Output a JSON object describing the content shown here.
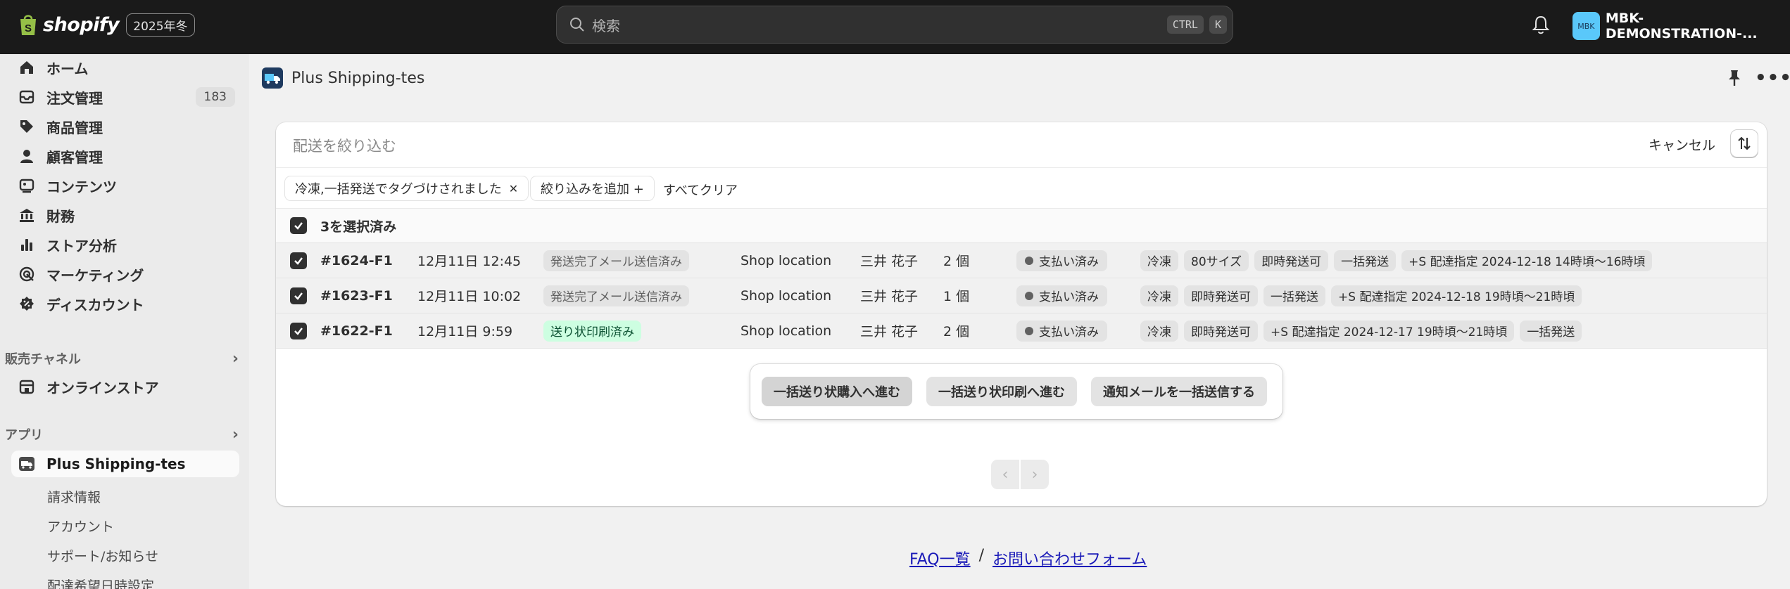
{
  "topbar": {
    "brand": "shopify",
    "edition": "2025年冬",
    "search_placeholder": "検索",
    "shortcut_keys": [
      "CTRL",
      "K"
    ],
    "store_avatar": "MBK",
    "store_name": "MBK-DEMONSTRATION-..."
  },
  "sidebar": {
    "items": [
      {
        "label": "ホーム",
        "icon": "home-icon"
      },
      {
        "label": "注文管理",
        "icon": "orders-icon",
        "badge": "183"
      },
      {
        "label": "商品管理",
        "icon": "tag-icon"
      },
      {
        "label": "顧客管理",
        "icon": "person-icon"
      },
      {
        "label": "コンテンツ",
        "icon": "content-icon"
      },
      {
        "label": "財務",
        "icon": "bank-icon"
      },
      {
        "label": "ストア分析",
        "icon": "analytics-icon"
      },
      {
        "label": "マーケティング",
        "icon": "target-icon"
      },
      {
        "label": "ディスカウント",
        "icon": "discount-icon"
      }
    ],
    "sales_channels_heading": "販売チャネル",
    "online_store": "オンラインストア",
    "apps_heading": "アプリ",
    "app_name": "Plus Shipping-tes",
    "app_sub_items": [
      "請求情報",
      "アカウント",
      "サポート/お知らせ",
      "配達希望日時設定"
    ]
  },
  "header": {
    "app_title": "Plus Shipping-tes"
  },
  "filter": {
    "placeholder": "配送を絞り込む",
    "cancel": "キャンセル",
    "active_chip": "冷凍,一括発送でタグづけされました",
    "add_filter": "絞り込みを追加 +",
    "clear_all": "すべてクリア"
  },
  "selection": {
    "label": "3を選択済み"
  },
  "orders": [
    {
      "no": "#1624-F1",
      "date": "12月11日 12:45",
      "status": "発送完了メール送信済み",
      "status_type": "gray",
      "location": "Shop location",
      "customer": "三井 花子",
      "qty": "2 個",
      "payment": "支払い済み",
      "tags": [
        "冷凍",
        "80サイズ",
        "即時発送可",
        "一括発送",
        "+S 配達指定 2024-12-18 14時頃〜16時頃"
      ]
    },
    {
      "no": "#1623-F1",
      "date": "12月11日 10:02",
      "status": "発送完了メール送信済み",
      "status_type": "gray",
      "location": "Shop location",
      "customer": "三井 花子",
      "qty": "1 個",
      "payment": "支払い済み",
      "tags": [
        "冷凍",
        "即時発送可",
        "一括発送",
        "+S 配達指定 2024-12-18 19時頃〜21時頃"
      ]
    },
    {
      "no": "#1622-F1",
      "date": "12月11日 9:59",
      "status": "送り状印刷済み",
      "status_type": "green",
      "location": "Shop location",
      "customer": "三井 花子",
      "qty": "2 個",
      "payment": "支払い済み",
      "tags": [
        "冷凍",
        "即時発送可",
        "+S 配達指定 2024-12-17 19時頃〜21時頃",
        "一括発送"
      ]
    }
  ],
  "bulk_actions": {
    "purchase_labels": "一括送り状購入へ進む",
    "print_labels": "一括送り状印刷へ進む",
    "send_notifications": "通知メールを一括送信する"
  },
  "footer": {
    "faq": "FAQ一覧",
    "separator": "/",
    "contact": "お問い合わせフォーム"
  },
  "colors": {
    "topbar_bg": "#1a1a1a",
    "accent_green_bg": "#cdfee1",
    "accent_green_text": "#0c5132",
    "link": "#1a1ab8"
  }
}
